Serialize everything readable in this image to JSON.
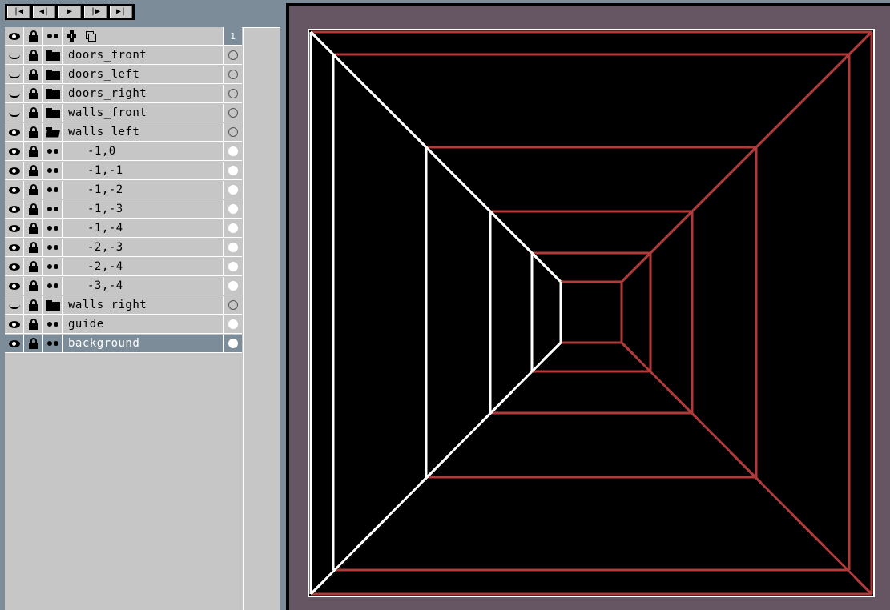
{
  "playback": {
    "buttons": [
      {
        "name": "first-frame-button",
        "glyph": "|◀"
      },
      {
        "name": "prev-frame-button",
        "glyph": "◀|"
      },
      {
        "name": "play-button",
        "glyph": "▶"
      },
      {
        "name": "next-frame-button",
        "glyph": "|▶"
      },
      {
        "name": "last-frame-button",
        "glyph": "▶|"
      }
    ]
  },
  "layers": {
    "header": {
      "frame_number": "1",
      "icons": [
        "eye-icon",
        "lock-icon",
        "continuous-icon",
        "link-icon",
        "stack-icon"
      ]
    },
    "rows": [
      {
        "name": "doors_front",
        "visible": false,
        "type": "folder",
        "cel": "empty",
        "indent": 0
      },
      {
        "name": "doors_left",
        "visible": false,
        "type": "folder",
        "cel": "empty",
        "indent": 0
      },
      {
        "name": "doors_right",
        "visible": false,
        "type": "folder",
        "cel": "empty",
        "indent": 0
      },
      {
        "name": "walls_front",
        "visible": false,
        "type": "folder",
        "cel": "empty",
        "indent": 0
      },
      {
        "name": "walls_left",
        "visible": true,
        "type": "folder-open",
        "cel": "empty",
        "indent": 0
      },
      {
        "name": "-1,0",
        "visible": true,
        "type": "layer",
        "cel": "full",
        "indent": 1
      },
      {
        "name": "-1,-1",
        "visible": true,
        "type": "layer",
        "cel": "full",
        "indent": 1
      },
      {
        "name": "-1,-2",
        "visible": true,
        "type": "layer",
        "cel": "full",
        "indent": 1
      },
      {
        "name": "-1,-3",
        "visible": true,
        "type": "layer",
        "cel": "full",
        "indent": 1
      },
      {
        "name": "-1,-4",
        "visible": true,
        "type": "layer",
        "cel": "full",
        "indent": 1
      },
      {
        "name": "-2,-3",
        "visible": true,
        "type": "layer",
        "cel": "full",
        "indent": 1
      },
      {
        "name": "-2,-4",
        "visible": true,
        "type": "layer",
        "cel": "full",
        "indent": 1
      },
      {
        "name": "-3,-4",
        "visible": true,
        "type": "layer",
        "cel": "full",
        "indent": 1
      },
      {
        "name": "walls_right",
        "visible": false,
        "type": "folder",
        "cel": "empty",
        "indent": 0
      },
      {
        "name": "guide",
        "visible": true,
        "type": "layer",
        "cel": "full",
        "indent": 0
      },
      {
        "name": "background",
        "visible": true,
        "type": "layer",
        "cel": "full",
        "indent": 0,
        "selected": true
      }
    ]
  },
  "canvas": {
    "colors": {
      "background": "#000000",
      "guide": "#b03a3a",
      "wall": "#ffffff",
      "frame": "#665563"
    }
  }
}
